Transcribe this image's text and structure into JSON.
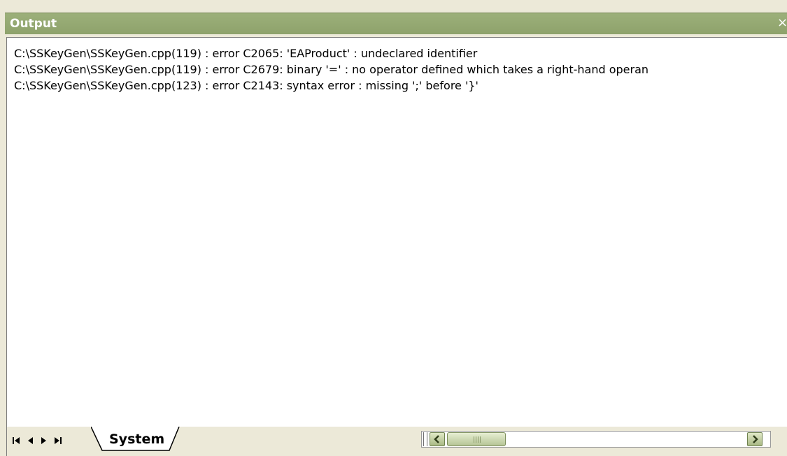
{
  "panel": {
    "title": "Output",
    "close_glyph": "×"
  },
  "output": {
    "lines": [
      "C:\\SSKeyGen\\SSKeyGen.cpp(119) : error C2065: 'EAProduct' : undeclared identifier",
      "C:\\SSKeyGen\\SSKeyGen.cpp(119) : error C2679: binary '=' : no operator defined which takes a right-hand operan",
      "C:\\SSKeyGen\\SSKeyGen.cpp(123) : error C2143: syntax error : missing ';' before '}'"
    ]
  },
  "bottom_bar": {
    "nav_icons": [
      "first-page-icon",
      "prev-page-icon",
      "next-page-icon",
      "last-page-icon"
    ],
    "tabs": [
      {
        "label": "System",
        "active": true
      }
    ]
  },
  "colors": {
    "titlebar": "#8ea26b",
    "title_text": "#ffffff",
    "background": "#ece9d8",
    "output_bg": "#ffffff"
  }
}
